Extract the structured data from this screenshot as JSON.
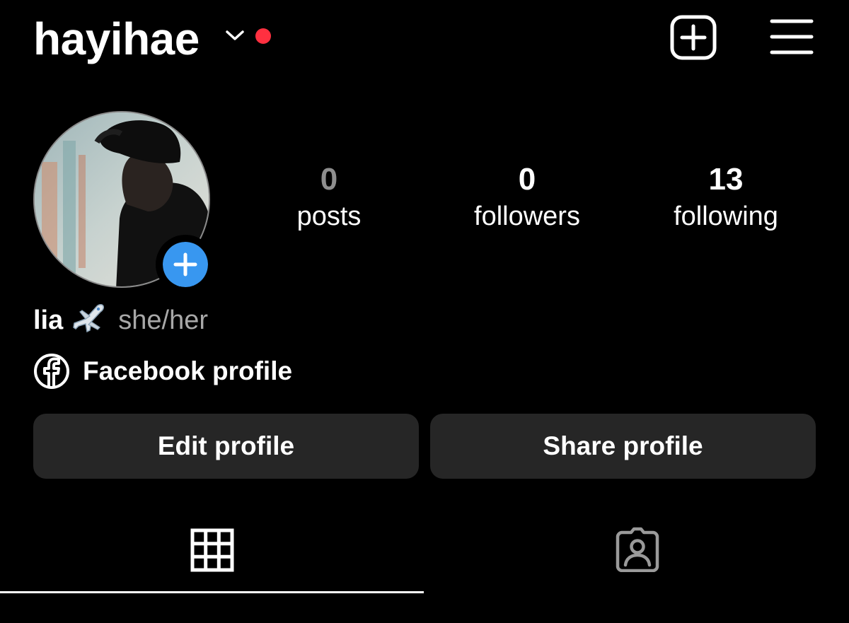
{
  "header": {
    "username": "hayihae",
    "switch_icon": "chevron-down-icon",
    "new_post_icon": "plus-square-icon",
    "menu_icon": "hamburger-menu-icon"
  },
  "profile": {
    "avatar_icon": "profile-photo",
    "add_story_icon": "plus-circle-icon",
    "stats": [
      {
        "count": "0",
        "label": "posts"
      },
      {
        "count": "0",
        "label": "followers"
      },
      {
        "count": "13",
        "label": "following"
      }
    ],
    "display_name": "lia",
    "name_emoji_icon": "airplane-emoji-icon",
    "pronouns": "she/her",
    "facebook_link": "Facebook profile",
    "facebook_icon": "facebook-icon"
  },
  "actions": {
    "edit_label": "Edit profile",
    "share_label": "Share profile"
  },
  "tabs": {
    "posts_icon": "grid-icon",
    "tagged_icon": "tagged-person-icon",
    "active": "posts"
  },
  "colors": {
    "background": "#000000",
    "notification_dot": "#ff3040",
    "accent_blue": "#3897f0",
    "button_bg": "#262626",
    "muted_text": "#8e8e8e"
  }
}
